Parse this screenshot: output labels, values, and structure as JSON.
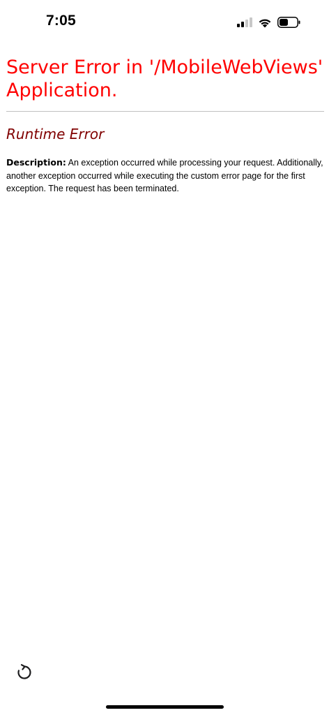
{
  "status_bar": {
    "time": "7:05",
    "icons": [
      "cellular-signal-icon",
      "wifi-icon",
      "battery-icon"
    ]
  },
  "page": {
    "title_line1": "Server Error in '/MobileWebViews'",
    "title_line2": "Application.",
    "subtitle": "Runtime Error",
    "description_label": "Description:",
    "description_text": " An exception occurred while processing your request. Additionally, another exception occurred while executing the custom error page for the first exception. The request has been terminated."
  },
  "toolbar": {
    "reload_icon": "reload-icon"
  },
  "colors": {
    "title": "#ff0000",
    "subtitle": "#800000",
    "divider": "#c0c0c0"
  }
}
